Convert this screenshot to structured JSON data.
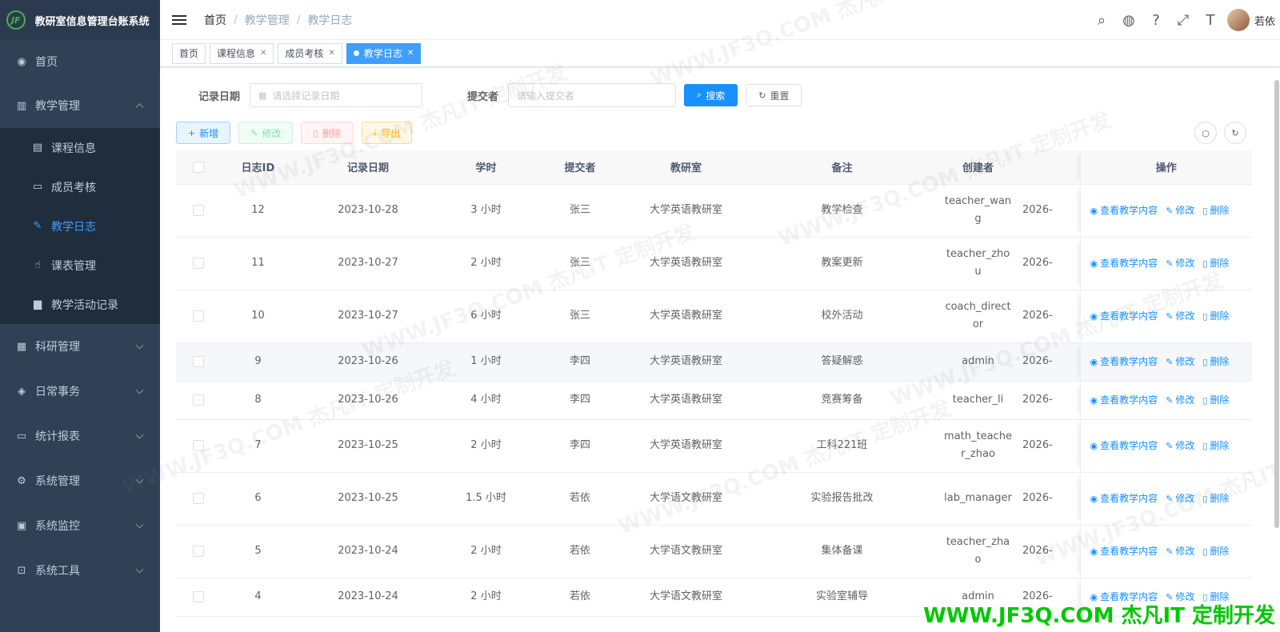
{
  "app": {
    "logo_text": "JF",
    "title": "教研室信息管理台账系统"
  },
  "sidebar": {
    "home": "首页",
    "teaching": {
      "label": "教学管理",
      "children": [
        "课程信息",
        "成员考核",
        "教学日志",
        "课表管理",
        "教学活动记录"
      ]
    },
    "groups": [
      "科研管理",
      "日常事务",
      "统计报表",
      "系统管理",
      "系统监控",
      "系统工具"
    ]
  },
  "header": {
    "breadcrumb": [
      "首页",
      "教学管理",
      "教学日志"
    ],
    "username": "若依"
  },
  "tags": [
    "首页",
    "课程信息",
    "成员考核",
    "教学日志"
  ],
  "search": {
    "date_label": "记录日期",
    "date_placeholder": "请选择记录日期",
    "submitter_label": "提交者",
    "submitter_placeholder": "请输入提交者",
    "search_btn": "搜索",
    "reset_btn": "重置"
  },
  "toolbar": {
    "add": "新增",
    "edit": "修改",
    "delete": "删除",
    "export": "导出"
  },
  "table": {
    "columns": [
      "日志ID",
      "记录日期",
      "学时",
      "提交者",
      "教研室",
      "备注",
      "创建者",
      "操作"
    ],
    "op_view": "查看教学内容",
    "op_edit": "修改",
    "op_delete": "删除",
    "rows": [
      {
        "id": "12",
        "date": "2023-10-28",
        "hours": "3 小时",
        "submitter": "张三",
        "office": "大学英语教研室",
        "remark": "教学检查",
        "creator": "teacher_wang",
        "created": "2026-"
      },
      {
        "id": "11",
        "date": "2023-10-27",
        "hours": "2 小时",
        "submitter": "张三",
        "office": "大学英语教研室",
        "remark": "教案更新",
        "creator": "teacher_zhou",
        "created": "2026-"
      },
      {
        "id": "10",
        "date": "2023-10-27",
        "hours": "6 小时",
        "submitter": "张三",
        "office": "大学英语教研室",
        "remark": "校外活动",
        "creator": "coach_director",
        "created": "2026-"
      },
      {
        "id": "9",
        "date": "2023-10-26",
        "hours": "1 小时",
        "submitter": "李四",
        "office": "大学英语教研室",
        "remark": "答疑解惑",
        "creator": "admin",
        "created": "2026-"
      },
      {
        "id": "8",
        "date": "2023-10-26",
        "hours": "4 小时",
        "submitter": "李四",
        "office": "大学英语教研室",
        "remark": "竞赛筹备",
        "creator": "teacher_li",
        "created": "2026-"
      },
      {
        "id": "7",
        "date": "2023-10-25",
        "hours": "2 小时",
        "submitter": "李四",
        "office": "大学英语教研室",
        "remark": "工科221班",
        "creator": "math_teacher_zhao",
        "created": "2026-"
      },
      {
        "id": "6",
        "date": "2023-10-25",
        "hours": "1.5 小时",
        "submitter": "若依",
        "office": "大学语文教研室",
        "remark": "实验报告批改",
        "creator": "lab_manager",
        "created": "2026-"
      },
      {
        "id": "5",
        "date": "2023-10-24",
        "hours": "2 小时",
        "submitter": "若依",
        "office": "大学语文教研室",
        "remark": "集体备课",
        "creator": "teacher_zhao",
        "created": "2026-"
      },
      {
        "id": "4",
        "date": "2023-10-24",
        "hours": "2 小时",
        "submitter": "若依",
        "office": "大学语文教研室",
        "remark": "实验室辅导",
        "creator": "admin",
        "created": "2026-"
      }
    ]
  },
  "watermark": {
    "text": "WWW.JF3Q.COM 杰凡IT 定制开发"
  }
}
